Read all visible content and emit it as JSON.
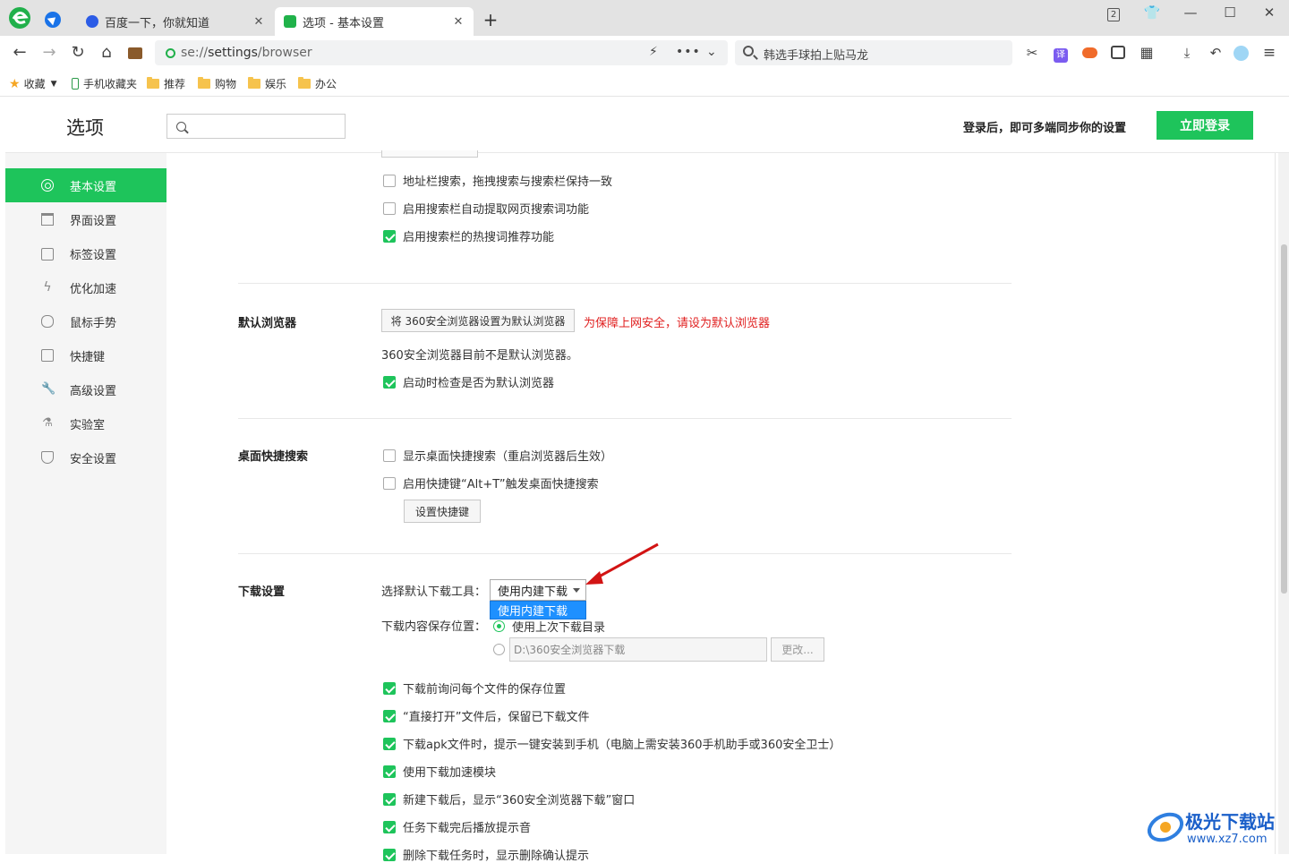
{
  "browser": {
    "tabs": [
      {
        "title": "百度一下，你就知道",
        "close": "✕"
      },
      {
        "title": "选项 - 基本设置",
        "close": "✕"
      }
    ],
    "new_tab": "+",
    "window_count": "2",
    "address": {
      "scheme": "se://",
      "host": "settings",
      "path": "/browser"
    },
    "search_text": "韩选手球拍上贴马龙",
    "bookmarks": [
      {
        "label": "收藏",
        "type": "favorites"
      },
      {
        "label": "手机收藏夹",
        "type": "phone"
      },
      {
        "label": "推荐",
        "type": "folder"
      },
      {
        "label": "购物",
        "type": "folder"
      },
      {
        "label": "娱乐",
        "type": "folder"
      },
      {
        "label": "办公",
        "type": "folder"
      }
    ],
    "translate_label": "译"
  },
  "settings": {
    "title": "选项",
    "search_placeholder": "",
    "login_prompt": "登录后，即可多端同步你的设置",
    "login_button": "立即登录",
    "accent_color": "#1ec45b",
    "sidebar": [
      {
        "label": "基本设置",
        "icon": "gear-icon",
        "active": true
      },
      {
        "label": "界面设置",
        "icon": "window-icon"
      },
      {
        "label": "标签设置",
        "icon": "tag-icon"
      },
      {
        "label": "优化加速",
        "icon": "bolt-icon"
      },
      {
        "label": "鼠标手势",
        "icon": "mouse-icon"
      },
      {
        "label": "快捷键",
        "icon": "keyboard-icon"
      },
      {
        "label": "高级设置",
        "icon": "wrench-icon"
      },
      {
        "label": "实验室",
        "icon": "flask-icon"
      },
      {
        "label": "安全设置",
        "icon": "shield-icon"
      }
    ],
    "search_section": {
      "options": [
        {
          "label": "地址栏搜索，拖拽搜索与搜索栏保持一致",
          "checked": false
        },
        {
          "label": "启用搜索栏自动提取网页搜索词功能",
          "checked": false
        },
        {
          "label": "启用搜索栏的热搜词推荐功能",
          "checked": true
        }
      ]
    },
    "default_browser": {
      "title": "默认浏览器",
      "set_button": "将 360安全浏览器设置为默认浏览器",
      "warning": "为保障上网安全，请设为默认浏览器",
      "status": "360安全浏览器目前不是默认浏览器。",
      "check_on_start": {
        "label": "启动时检查是否为默认浏览器",
        "checked": true
      }
    },
    "desktop_search": {
      "title": "桌面快捷搜索",
      "options": [
        {
          "label": "显示桌面快捷搜索（重启浏览器后生效）",
          "checked": false
        },
        {
          "label": "启用快捷键“Alt+T”触发桌面快捷搜索",
          "checked": false
        }
      ],
      "shortcut_button": "设置快捷键"
    },
    "download": {
      "title": "下载设置",
      "tool_label": "选择默认下载工具：",
      "tool_selected": "使用内建下载",
      "tool_options": [
        "使用内建下载"
      ],
      "location_label": "下载内容保存位置：",
      "location_last": "使用上次下载目录",
      "location_path": "D:\\360安全浏览器下载",
      "change_button": "更改...",
      "options": [
        {
          "label": "下载前询问每个文件的保存位置",
          "checked": true
        },
        {
          "label": "“直接打开”文件后，保留已下载文件",
          "checked": true
        },
        {
          "label": "下载apk文件时，提示一键安装到手机（电脑上需安装360手机助手或360安全卫士）",
          "checked": true
        },
        {
          "label": "使用下载加速模块",
          "checked": true
        },
        {
          "label": "新建下载后，显示“360安全浏览器下载”窗口",
          "checked": true
        },
        {
          "label": "任务下载完后播放提示音",
          "checked": true
        },
        {
          "label": "删除下载任务时，显示删除确认提示",
          "checked": true
        }
      ]
    }
  },
  "watermark": {
    "title": "极光下载站",
    "url": "www.xz7.com"
  }
}
